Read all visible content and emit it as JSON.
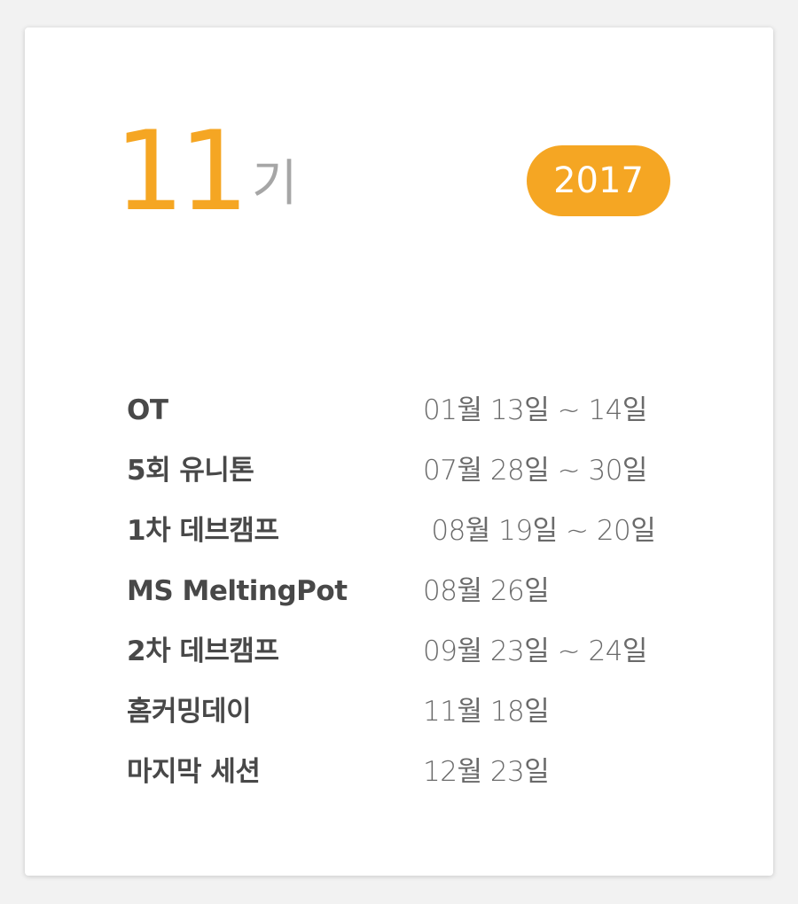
{
  "header": {
    "generation_number": "11",
    "generation_suffix": "기",
    "year": "2017"
  },
  "colors": {
    "accent": "#f5a623",
    "title_text": "#484848",
    "date_text": "#6a6a6a",
    "suffix_text": "#a6a6a6",
    "card_background": "#ffffff",
    "page_background": "#f2f2f2"
  },
  "schedule": [
    {
      "event": "OT",
      "date": "01월 13일 ~ 14일"
    },
    {
      "event": "5회 유니톤",
      "date": "07월 28일 ~ 30일"
    },
    {
      "event": "1차 데브캠프",
      "date": " 08월 19일 ~ 20일"
    },
    {
      "event": "MS MeltingPot",
      "date": "08월 26일"
    },
    {
      "event": "2차 데브캠프",
      "date": "09월 23일 ~ 24일"
    },
    {
      "event": "홈커밍데이",
      "date": "11월 18일"
    },
    {
      "event": "마지막 세션",
      "date": "12월 23일"
    }
  ]
}
